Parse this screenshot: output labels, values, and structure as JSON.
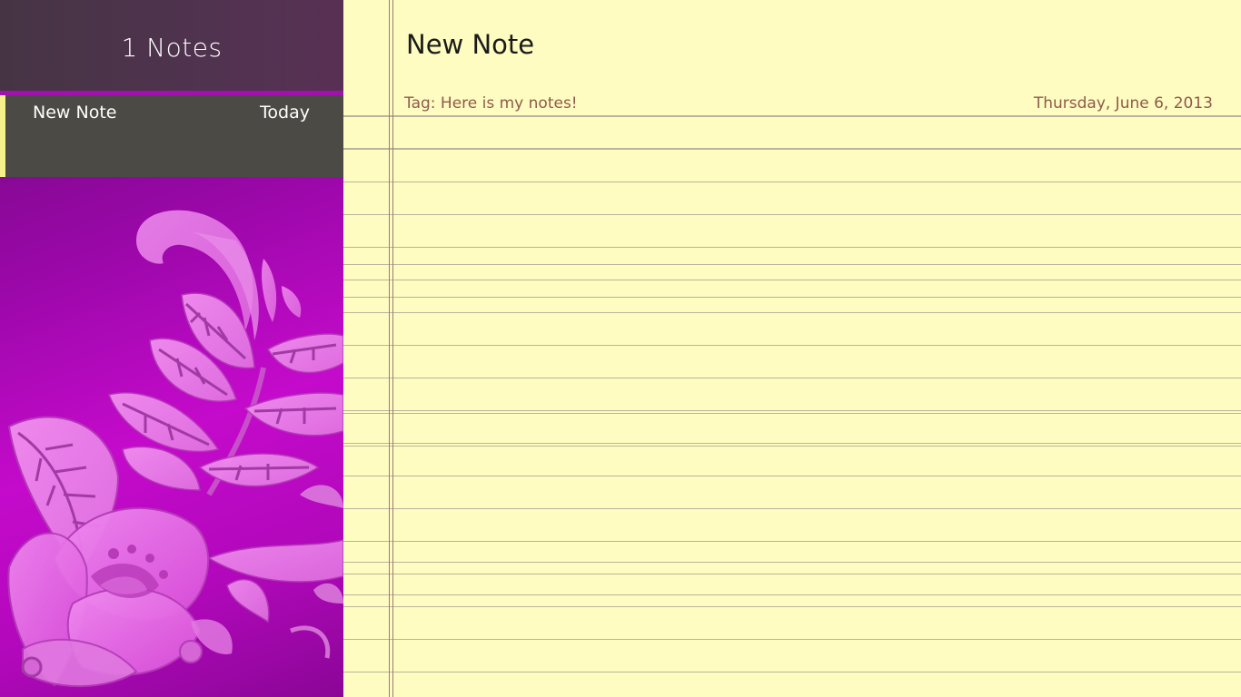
{
  "sidebar": {
    "title": "1 Notes",
    "accent_color": "#a40fb0",
    "selected_marker_color": "#f6f18a",
    "notes": [
      {
        "title": "New Note",
        "date": "Today"
      }
    ]
  },
  "editor": {
    "note_title": "New Note",
    "tag": "Tag: Here is my notes!",
    "date": "Thursday, June 6, 2013",
    "paper_color": "#fefcc0",
    "line_color": "#b8b59b",
    "margin_line_color": "#a0797a"
  }
}
